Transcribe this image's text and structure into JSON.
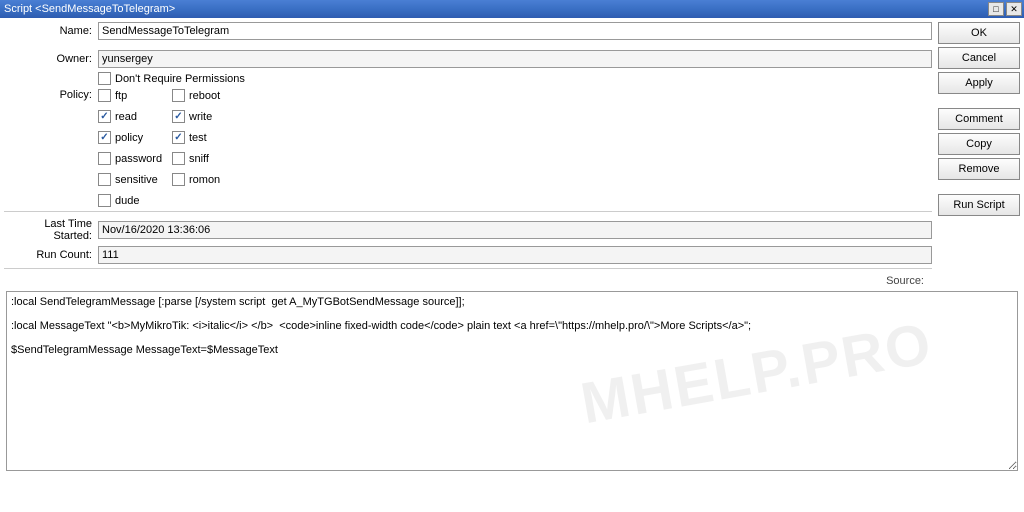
{
  "window": {
    "title": "Script <SendMessageToTelegram>"
  },
  "form": {
    "name_label": "Name:",
    "name_value": "SendMessageToTelegram",
    "owner_label": "Owner:",
    "owner_value": "yunsergey",
    "dont_require_label": "Don't Require Permissions",
    "policy_label": "Policy:",
    "policies": [
      {
        "label": "ftp",
        "checked": false
      },
      {
        "label": "reboot",
        "checked": false
      },
      {
        "label": "read",
        "checked": true
      },
      {
        "label": "write",
        "checked": true
      },
      {
        "label": "policy",
        "checked": true
      },
      {
        "label": "test",
        "checked": true
      },
      {
        "label": "password",
        "checked": false
      },
      {
        "label": "sniff",
        "checked": false
      },
      {
        "label": "sensitive",
        "checked": false
      },
      {
        "label": "romon",
        "checked": false
      },
      {
        "label": "dude",
        "checked": false
      }
    ],
    "last_time_label": "Last Time Started:",
    "last_time_value": "Nov/16/2020 13:36:06",
    "run_count_label": "Run Count:",
    "run_count_value": "111",
    "source_label": "Source:",
    "source_value": ":local SendTelegramMessage [:parse [/system script  get A_MyTGBotSendMessage source]];\n\n:local MessageText \"<b>MyMikroTik: <i>italic</i> </b>  <code>inline fixed-width code</code> plain text <a href=\\\"https://mhelp.pro/\\\">More Scripts</a>\";\n\n$SendTelegramMessage MessageText=$MessageText"
  },
  "buttons": {
    "ok": "OK",
    "cancel": "Cancel",
    "apply": "Apply",
    "comment": "Comment",
    "copy": "Copy",
    "remove": "Remove",
    "run_script": "Run Script"
  },
  "watermark": "MHELP.PRO"
}
